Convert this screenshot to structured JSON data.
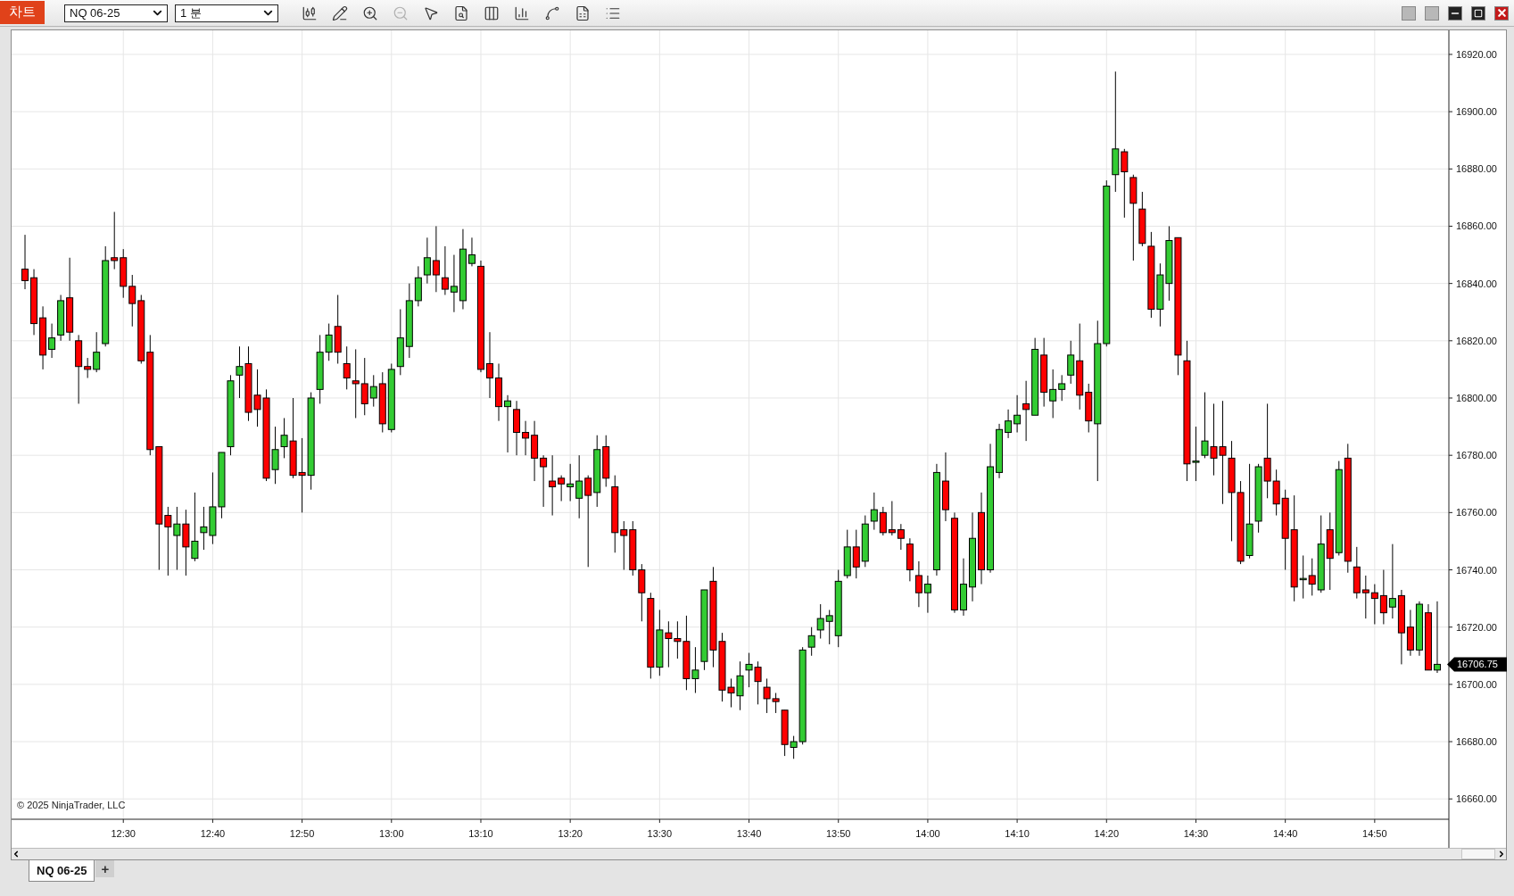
{
  "toolbar": {
    "logo": "차트",
    "instrument": "NQ 06-25",
    "interval": "1 분"
  },
  "chart": {
    "copyright": "© 2025 NinjaTrader, LLC",
    "last_price": "16706.75",
    "chart_data": {
      "type": "candlestick",
      "grid": true,
      "ylim": [
        16652.9,
        16928.4
      ],
      "yticks": [
        {
          "value": 16660,
          "label": "16660.00"
        },
        {
          "value": 16680,
          "label": "16680.00"
        },
        {
          "value": 16700,
          "label": "16700.00"
        },
        {
          "value": 16720,
          "label": "16720.00"
        },
        {
          "value": 16740,
          "label": "16740.00"
        },
        {
          "value": 16760,
          "label": "16760.00"
        },
        {
          "value": 16780,
          "label": "16780.00"
        },
        {
          "value": 16800,
          "label": "16800.00"
        },
        {
          "value": 16820,
          "label": "16820.00"
        },
        {
          "value": 16840,
          "label": "16840.00"
        },
        {
          "value": 16860,
          "label": "16860.00"
        },
        {
          "value": 16880,
          "label": "16880.00"
        },
        {
          "value": 16900,
          "label": "16900.00"
        },
        {
          "value": 16920,
          "label": "16920.00"
        }
      ],
      "xlim": [
        737.5,
        898.3
      ],
      "xticks": [
        {
          "value": 750,
          "label": "12:30"
        },
        {
          "value": 760,
          "label": "12:40"
        },
        {
          "value": 770,
          "label": "12:50"
        },
        {
          "value": 780,
          "label": "13:00"
        },
        {
          "value": 790,
          "label": "13:10"
        },
        {
          "value": 800,
          "label": "13:20"
        },
        {
          "value": 810,
          "label": "13:30"
        },
        {
          "value": 820,
          "label": "13:40"
        },
        {
          "value": 830,
          "label": "13:50"
        },
        {
          "value": 840,
          "label": "14:00"
        },
        {
          "value": 850,
          "label": "14:10"
        },
        {
          "value": 860,
          "label": "14:20"
        },
        {
          "value": 870,
          "label": "14:30"
        },
        {
          "value": 880,
          "label": "14:40"
        },
        {
          "value": 890,
          "label": "14:50"
        }
      ],
      "x": [
        739,
        740,
        741,
        742,
        743,
        744,
        745,
        746,
        747,
        748,
        749,
        750,
        751,
        752,
        753,
        754,
        755,
        756,
        757,
        758,
        759,
        760,
        761,
        762,
        763,
        764,
        765,
        766,
        767,
        768,
        769,
        770,
        771,
        772,
        773,
        774,
        775,
        776,
        777,
        778,
        779,
        780,
        781,
        782,
        783,
        784,
        785,
        786,
        787,
        788,
        789,
        790,
        791,
        792,
        793,
        794,
        795,
        796,
        797,
        798,
        799,
        800,
        801,
        802,
        803,
        804,
        805,
        806,
        807,
        808,
        809,
        810,
        811,
        812,
        813,
        814,
        815,
        816,
        817,
        818,
        819,
        820,
        821,
        822,
        823,
        824,
        825,
        826,
        827,
        828,
        829,
        830,
        831,
        832,
        833,
        834,
        835,
        836,
        837,
        838,
        839,
        840,
        841,
        842,
        843,
        844,
        845,
        846,
        847,
        848,
        849,
        850,
        851,
        852,
        853,
        854,
        855,
        856,
        857,
        858,
        859,
        860,
        861,
        862,
        863,
        864,
        865,
        866,
        867,
        868,
        869,
        870,
        871,
        872,
        873,
        874,
        875,
        876,
        877,
        878,
        879,
        880,
        881,
        882,
        883,
        884,
        885,
        886,
        887,
        888,
        889,
        890,
        891,
        892,
        893,
        894,
        895,
        896,
        897
      ],
      "ohlc": [
        [
          16845,
          16857,
          16838,
          16841
        ],
        [
          16842,
          16845,
          16822,
          16826
        ],
        [
          16828,
          16832,
          16810,
          16815
        ],
        [
          16817,
          16826,
          16814,
          16821
        ],
        [
          16822,
          16836,
          16820,
          16834
        ],
        [
          16835,
          16849,
          16820,
          16823
        ],
        [
          16820,
          16822,
          16798,
          16811
        ],
        [
          16811,
          16814,
          16807,
          16810
        ],
        [
          16810,
          16823,
          16809,
          16816
        ],
        [
          16819,
          16853,
          16818,
          16848
        ],
        [
          16849,
          16865,
          16845,
          16848
        ],
        [
          16849,
          16852,
          16835,
          16839
        ],
        [
          16839,
          16843,
          16825,
          16833
        ],
        [
          16834,
          16836,
          16812,
          16813
        ],
        [
          16816,
          16822,
          16780,
          16782
        ],
        [
          16783,
          16783,
          16740,
          16756
        ],
        [
          16759,
          16762,
          16738,
          16755
        ],
        [
          16752,
          16762,
          16740,
          16756
        ],
        [
          16756,
          16761,
          16738,
          16748
        ],
        [
          16744,
          16767,
          16743,
          16750
        ],
        [
          16753,
          16762,
          16747,
          16755
        ],
        [
          16752,
          16774,
          16749,
          16762
        ],
        [
          16762,
          16781,
          16758,
          16781
        ],
        [
          16783,
          16808,
          16780,
          16806
        ],
        [
          16808,
          16818,
          16800,
          16811
        ],
        [
          16812,
          16818,
          16792,
          16795
        ],
        [
          16801,
          16810,
          16790,
          16796
        ],
        [
          16800,
          16803,
          16771,
          16772
        ],
        [
          16775,
          16790,
          16770,
          16782
        ],
        [
          16783,
          16793,
          16779,
          16787
        ],
        [
          16785,
          16800,
          16772,
          16773
        ],
        [
          16774,
          16786,
          16760,
          16773
        ],
        [
          16773,
          16802,
          16768,
          16800
        ],
        [
          16803,
          16822,
          16798,
          16816
        ],
        [
          16816,
          16826,
          16813,
          16822
        ],
        [
          16825,
          16836,
          16812,
          16816
        ],
        [
          16812,
          16818,
          16803,
          16807
        ],
        [
          16806,
          16817,
          16793,
          16805
        ],
        [
          16805,
          16814,
          16794,
          16798
        ],
        [
          16800,
          16808,
          16797,
          16804
        ],
        [
          16805,
          16809,
          16788,
          16791
        ],
        [
          16789,
          16812,
          16788,
          16810
        ],
        [
          16811,
          16831,
          16808,
          16821
        ],
        [
          16818,
          16840,
          16814,
          16834
        ],
        [
          16834,
          16846,
          16832,
          16842
        ],
        [
          16843,
          16856,
          16840,
          16849
        ],
        [
          16848,
          16860,
          16837,
          16843
        ],
        [
          16842,
          16853,
          16836,
          16838
        ],
        [
          16837,
          16850,
          16830,
          16839
        ],
        [
          16834,
          16859,
          16831,
          16852
        ],
        [
          16847,
          16856,
          16846,
          16850
        ],
        [
          16846,
          16848,
          16809,
          16810
        ],
        [
          16812,
          16823,
          16800,
          16807
        ],
        [
          16807,
          16812,
          16792,
          16797
        ],
        [
          16797,
          16801,
          16781,
          16799
        ],
        [
          16796,
          16799,
          16780,
          16788
        ],
        [
          16788,
          16792,
          16780,
          16786
        ],
        [
          16787,
          16792,
          16771,
          16779
        ],
        [
          16779,
          16780,
          16762,
          16776
        ],
        [
          16771,
          16780,
          16759,
          16769
        ],
        [
          16772,
          16773,
          16764,
          16770
        ],
        [
          16769,
          16777,
          16764,
          16770
        ],
        [
          16765,
          16780,
          16758,
          16771
        ],
        [
          16772,
          16773,
          16741,
          16766
        ],
        [
          16767,
          16787,
          16762,
          16782
        ],
        [
          16783,
          16787,
          16769,
          16772
        ],
        [
          16769,
          16773,
          16746,
          16753
        ],
        [
          16754,
          16757,
          16740,
          16752
        ],
        [
          16754,
          16757,
          16738,
          16740
        ],
        [
          16740,
          16742,
          16722,
          16732
        ],
        [
          16730,
          16732,
          16702,
          16706
        ],
        [
          16706,
          16726,
          16703,
          16719
        ],
        [
          16718,
          16722,
          16706,
          16716
        ],
        [
          16716,
          16722,
          16709,
          16715
        ],
        [
          16715,
          16724,
          16698,
          16702
        ],
        [
          16702,
          16713,
          16697,
          16705
        ],
        [
          16708,
          16733,
          16705,
          16733
        ],
        [
          16736,
          16741,
          16706,
          16712
        ],
        [
          16715,
          16718,
          16694,
          16698
        ],
        [
          16699,
          16702,
          16692,
          16697
        ],
        [
          16696,
          16708,
          16691,
          16703
        ],
        [
          16705,
          16711,
          16699,
          16707
        ],
        [
          16706,
          16708,
          16693,
          16701
        ],
        [
          16699,
          16702,
          16690,
          16695
        ],
        [
          16695,
          16697,
          16690,
          16694
        ],
        [
          16691,
          16691,
          16675,
          16679
        ],
        [
          16678,
          16682,
          16674,
          16680
        ],
        [
          16680,
          16713,
          16679,
          16712
        ],
        [
          16713,
          16720,
          16710,
          16717
        ],
        [
          16719,
          16728,
          16716,
          16723
        ],
        [
          16722,
          16726,
          16714,
          16724
        ],
        [
          16717,
          16740,
          16713,
          16736
        ],
        [
          16738,
          16754,
          16737,
          16748
        ],
        [
          16748,
          16754,
          16737,
          16741
        ],
        [
          16743,
          16759,
          16741,
          16756
        ],
        [
          16757,
          16767,
          16754,
          16761
        ],
        [
          16760,
          16762,
          16752,
          16753
        ],
        [
          16754,
          16764,
          16752,
          16753
        ],
        [
          16754,
          16756,
          16747,
          16751
        ],
        [
          16749,
          16751,
          16736,
          16740
        ],
        [
          16738,
          16743,
          16727,
          16732
        ],
        [
          16732,
          16738,
          16725,
          16735
        ],
        [
          16740,
          16777,
          16738,
          16774
        ],
        [
          16771,
          16781,
          16757,
          16761
        ],
        [
          16758,
          16760,
          16725,
          16726
        ],
        [
          16726,
          16744,
          16724,
          16735
        ],
        [
          16734,
          16760,
          16729,
          16751
        ],
        [
          16760,
          16767,
          16735,
          16740
        ],
        [
          16740,
          16784,
          16739,
          16776
        ],
        [
          16774,
          16791,
          16772,
          16789
        ],
        [
          16788,
          16796,
          16786,
          16792
        ],
        [
          16791,
          16801,
          16788,
          16794
        ],
        [
          16798,
          16806,
          16785,
          16796
        ],
        [
          16794,
          16821,
          16794,
          16817
        ],
        [
          16815,
          16821,
          16797,
          16802
        ],
        [
          16799,
          16810,
          16793,
          16803
        ],
        [
          16803,
          16808,
          16799,
          16805
        ],
        [
          16808,
          16820,
          16805,
          16815
        ],
        [
          16813,
          16826,
          16796,
          16801
        ],
        [
          16802,
          16805,
          16788,
          16792
        ],
        [
          16791,
          16827,
          16771,
          16819
        ],
        [
          16819,
          16876,
          16818,
          16874
        ],
        [
          16878,
          16914,
          16872,
          16887
        ],
        [
          16886,
          16887,
          16863,
          16879
        ],
        [
          16877,
          16878,
          16848,
          16868
        ],
        [
          16866,
          16872,
          16853,
          16854
        ],
        [
          16853,
          16858,
          16828,
          16831
        ],
        [
          16831,
          16847,
          16825,
          16843
        ],
        [
          16840,
          16860,
          16834,
          16855
        ],
        [
          16856,
          16856,
          16808,
          16815
        ],
        [
          16813,
          16820,
          16771,
          16777
        ],
        [
          16778,
          16790,
          16771,
          16778
        ],
        [
          16780,
          16802,
          16779,
          16785
        ],
        [
          16783,
          16798,
          16773,
          16779
        ],
        [
          16783,
          16799,
          16763,
          16780
        ],
        [
          16779,
          16785,
          16750,
          16767
        ],
        [
          16767,
          16771,
          16742,
          16743
        ],
        [
          16745,
          16777,
          16744,
          16756
        ],
        [
          16757,
          16777,
          16753,
          16776
        ],
        [
          16779,
          16798,
          16765,
          16771
        ],
        [
          16771,
          16775,
          16759,
          16763
        ],
        [
          16765,
          16768,
          16740,
          16751
        ],
        [
          16754,
          16766,
          16729,
          16734
        ],
        [
          16737,
          16745,
          16730,
          16737
        ],
        [
          16738,
          16744,
          16731,
          16735
        ],
        [
          16733,
          16759,
          16732,
          16749
        ],
        [
          16754,
          16760,
          16733,
          16744
        ],
        [
          16746,
          16778,
          16745,
          16775
        ],
        [
          16779,
          16784,
          16739,
          16743
        ],
        [
          16741,
          16748,
          16730,
          16732
        ],
        [
          16733,
          16738,
          16723,
          16732
        ],
        [
          16732,
          16735,
          16721,
          16730
        ],
        [
          16731,
          16740,
          16721,
          16725
        ],
        [
          16727,
          16749,
          16723,
          16730
        ],
        [
          16731,
          16733,
          16707,
          16718
        ],
        [
          16720,
          16726,
          16710,
          16712
        ],
        [
          16712,
          16729,
          16710,
          16728
        ],
        [
          16725,
          16728,
          16705,
          16705
        ],
        [
          16705,
          16729,
          16704,
          16707
        ]
      ]
    }
  },
  "tabs": [
    {
      "label": "NQ 06-25",
      "selected": true
    }
  ],
  "add_tab": "+"
}
